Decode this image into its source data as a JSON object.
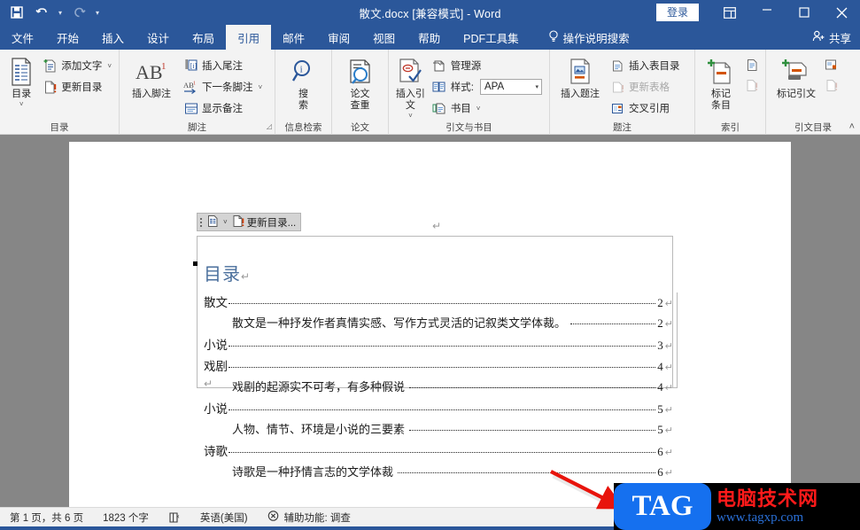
{
  "window": {
    "title": "散文.docx [兼容模式]  -  Word",
    "signin_label": "登录",
    "qat": [
      {
        "name": "save-icon",
        "glyph": "💾"
      },
      {
        "name": "undo-icon",
        "glyph": "↶"
      },
      {
        "name": "redo-icon",
        "glyph": "↻"
      },
      {
        "name": "customize-qat-icon",
        "glyph": "≡"
      }
    ],
    "controls": {
      "ribbon_display": "☷",
      "minimize": "—",
      "maximize": "☐",
      "close": "✕"
    }
  },
  "tabs": [
    {
      "label": "文件",
      "active": false
    },
    {
      "label": "开始",
      "active": false
    },
    {
      "label": "插入",
      "active": false
    },
    {
      "label": "设计",
      "active": false
    },
    {
      "label": "布局",
      "active": false
    },
    {
      "label": "引用",
      "active": true
    },
    {
      "label": "邮件",
      "active": false
    },
    {
      "label": "审阅",
      "active": false
    },
    {
      "label": "视图",
      "active": false
    },
    {
      "label": "帮助",
      "active": false
    },
    {
      "label": "PDF工具集",
      "active": false
    }
  ],
  "tellme": {
    "label": "操作说明搜索",
    "icon": "lightbulb-icon"
  },
  "share": {
    "label": "共享",
    "icon": "person-share-icon"
  },
  "ribbon": {
    "groups": [
      {
        "label": "目录",
        "big": {
          "label": "目录",
          "caret": "˅"
        },
        "items": [
          {
            "label": "添加文字",
            "caret": "˅",
            "disabled": false
          },
          {
            "label": "更新目录",
            "caret": "",
            "disabled": false
          }
        ]
      },
      {
        "label": "脚注",
        "big": {
          "label": "插入脚注",
          "sup": "1",
          "text": "AB"
        },
        "items": [
          {
            "label": "插入尾注",
            "caret": "",
            "disabled": false
          },
          {
            "label": "下一条脚注",
            "caret": "˅",
            "disabled": false
          },
          {
            "label": "显示备注",
            "caret": "",
            "disabled": false
          }
        ],
        "dialog_launcher": true
      },
      {
        "label": "信息检索",
        "big": {
          "label": "搜\n索"
        }
      },
      {
        "label": "论文",
        "big": {
          "label": "论文\n查重"
        }
      },
      {
        "label": "引文与书目",
        "big": {
          "label": "插入引文",
          "caret": "˅"
        },
        "items": [
          {
            "label": "管理源",
            "caret": "",
            "disabled": false
          },
          {
            "label": "样式:",
            "combo_value": "APA",
            "caret": "▾",
            "disabled": false
          },
          {
            "label": "书目",
            "caret": "˅",
            "disabled": false
          }
        ]
      },
      {
        "label": "题注",
        "big": {
          "label": "插入题注"
        },
        "items": [
          {
            "label": "插入表目录",
            "caret": "",
            "disabled": false
          },
          {
            "label": "更新表格",
            "caret": "",
            "disabled": true
          },
          {
            "label": "交叉引用",
            "caret": "",
            "disabled": false
          }
        ]
      },
      {
        "label": "索引",
        "big": {
          "label": "标记\n条目"
        }
      },
      {
        "label": "引文目录",
        "big": {
          "label": "标记引文"
        }
      }
    ],
    "collapse_icon": "˄"
  },
  "document": {
    "field_toolbar": {
      "label": "更新目录...",
      "caret": "˅"
    },
    "toc_heading": "目录",
    "pilcrow": "↵",
    "entries": [
      {
        "text": "散文",
        "page": "2",
        "level": 1
      },
      {
        "text": "散文是一种抒发作者真情实感、写作方式灵活的记叙类文学体裁。",
        "page": "2",
        "level": 2
      },
      {
        "text": "小说",
        "page": "3",
        "level": 1
      },
      {
        "text": "戏剧",
        "page": "4",
        "level": 1
      },
      {
        "text": "戏剧的起源实不可考，有多种假说",
        "page": "4",
        "level": 2
      },
      {
        "text": "小说",
        "page": "5",
        "level": 1
      },
      {
        "text": "人物、情节、环境是小说的三要素",
        "page": "5",
        "level": 2
      },
      {
        "text": "诗歌",
        "page": "6",
        "level": 1
      },
      {
        "text": "诗歌是一种抒情言志的文学体裁",
        "page": "6",
        "level": 2
      }
    ]
  },
  "statusbar": {
    "page_info": "第 1 页，共 6 页",
    "word_count": "1823 个字",
    "proofing_icon": "proofing-errors-icon",
    "language": "英语(美国)",
    "accessibility": "辅助功能: 调查",
    "view_icon": "read-mode-icon"
  },
  "watermark": {
    "badge": "TAG",
    "site_name": "电脑技术网",
    "url": "www.tagxp.com"
  },
  "colors": {
    "title_blue": "#2b579a",
    "ribbon_bg": "#f3f3f3",
    "canvas_gray": "#868686",
    "toc_heading_blue": "#4a6f9c",
    "arrow_red": "#e8140c",
    "badge_blue": "#1570ef"
  }
}
